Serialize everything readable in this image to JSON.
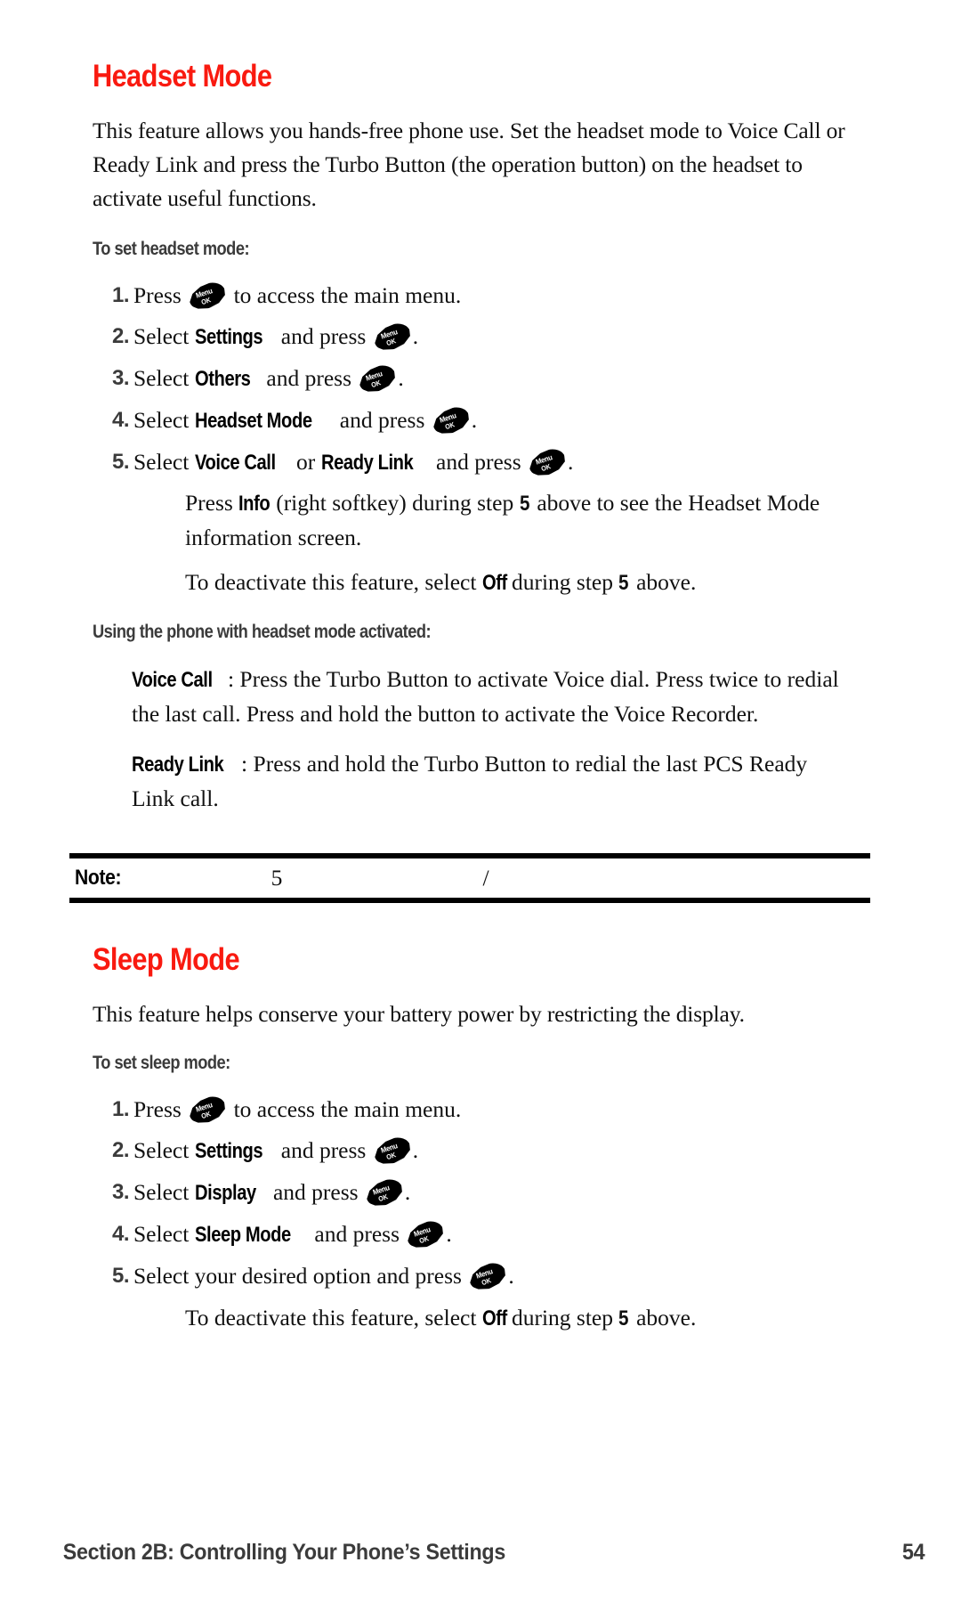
{
  "document": {
    "type": "phone-user-guide-page",
    "page_number": "54",
    "footer_text": "Section 2B: Controlling Your Phone’s Settings",
    "accent_color": "#f91a10",
    "heading_color": "#3b3b3b",
    "body_color": "#111111"
  },
  "icons": {
    "menu_ok_key": {
      "name": "menu-ok-key-icon",
      "label_top": "Menu",
      "label_bottom": "OK"
    }
  },
  "sections": [
    {
      "id": "headset-mode",
      "title": "Headset Mode",
      "intro": "This feature allows you hands-free phone use. Set the headset mode to Voice Call or Ready Link and press the Turbo Button (the operation button) on the headset to activate useful functions.",
      "subhead_1": "To set headset mode:",
      "steps": [
        {
          "num": "1.",
          "pre": "Press",
          "post": "to access the main menu."
        },
        {
          "num": "2.",
          "pre": "Select",
          "bold1": "Settings",
          "mid": "and press",
          "post": "."
        },
        {
          "num": "3.",
          "pre": "Select",
          "bold1": "Others",
          "mid": "and press",
          "post": "."
        },
        {
          "num": "4.",
          "pre": "Select",
          "bold1": "Headset Mode",
          "mid": "and press",
          "post": "."
        },
        {
          "num": "5.",
          "pre": "Select",
          "bold1": "Voice Call",
          "conj": "or",
          "bold2": "Ready Link",
          "mid": "and press",
          "post": "."
        }
      ],
      "notes": [
        {
          "pre": "Press",
          "bold": "Info",
          "mid": "(right softkey) during step",
          "bold_num": "5",
          "post": "above to see the Headset Mode information screen."
        },
        {
          "pre": "To deactivate this feature, select",
          "bold": "Off",
          "mid": "during step",
          "bold_num": "5",
          "post": "above."
        }
      ],
      "subhead_2": "Using the phone with headset mode activated:",
      "definitions": [
        {
          "term": "Voice Call",
          "sep": ":",
          "text": "Press the Turbo Button to activate Voice dial. Press twice to redial the last call. Press and hold the button to activate the Voice Recorder."
        },
        {
          "term": "Ready Link",
          "sep": ":",
          "text": "Press and hold the Turbo Button to redial the last PCS Ready Link call."
        }
      ],
      "note_band": {
        "label": "Note:",
        "cell_a": "5",
        "cell_b": "/",
        "cell_c": ""
      }
    },
    {
      "id": "sleep-mode",
      "title": "Sleep Mode",
      "intro": "This feature helps conserve your battery power by restricting the display.",
      "subhead_1": "To set sleep mode:",
      "steps": [
        {
          "num": "1.",
          "pre": "Press",
          "post": "to access the main menu."
        },
        {
          "num": "2.",
          "pre": "Select",
          "bold1": "Settings",
          "mid": "and press",
          "post": "."
        },
        {
          "num": "3.",
          "pre": "Select",
          "bold1": "Display",
          "mid": "and press",
          "post": "."
        },
        {
          "num": "4.",
          "pre": "Select",
          "bold1": "Sleep Mode",
          "mid": "and press",
          "post": "."
        },
        {
          "num": "5.",
          "pre": "Select your desired option and press",
          "post": "."
        }
      ],
      "notes": [
        {
          "pre": "To deactivate this feature, select",
          "bold": "Off",
          "mid": "during step",
          "bold_num": "5",
          "post": "above."
        }
      ]
    }
  ]
}
